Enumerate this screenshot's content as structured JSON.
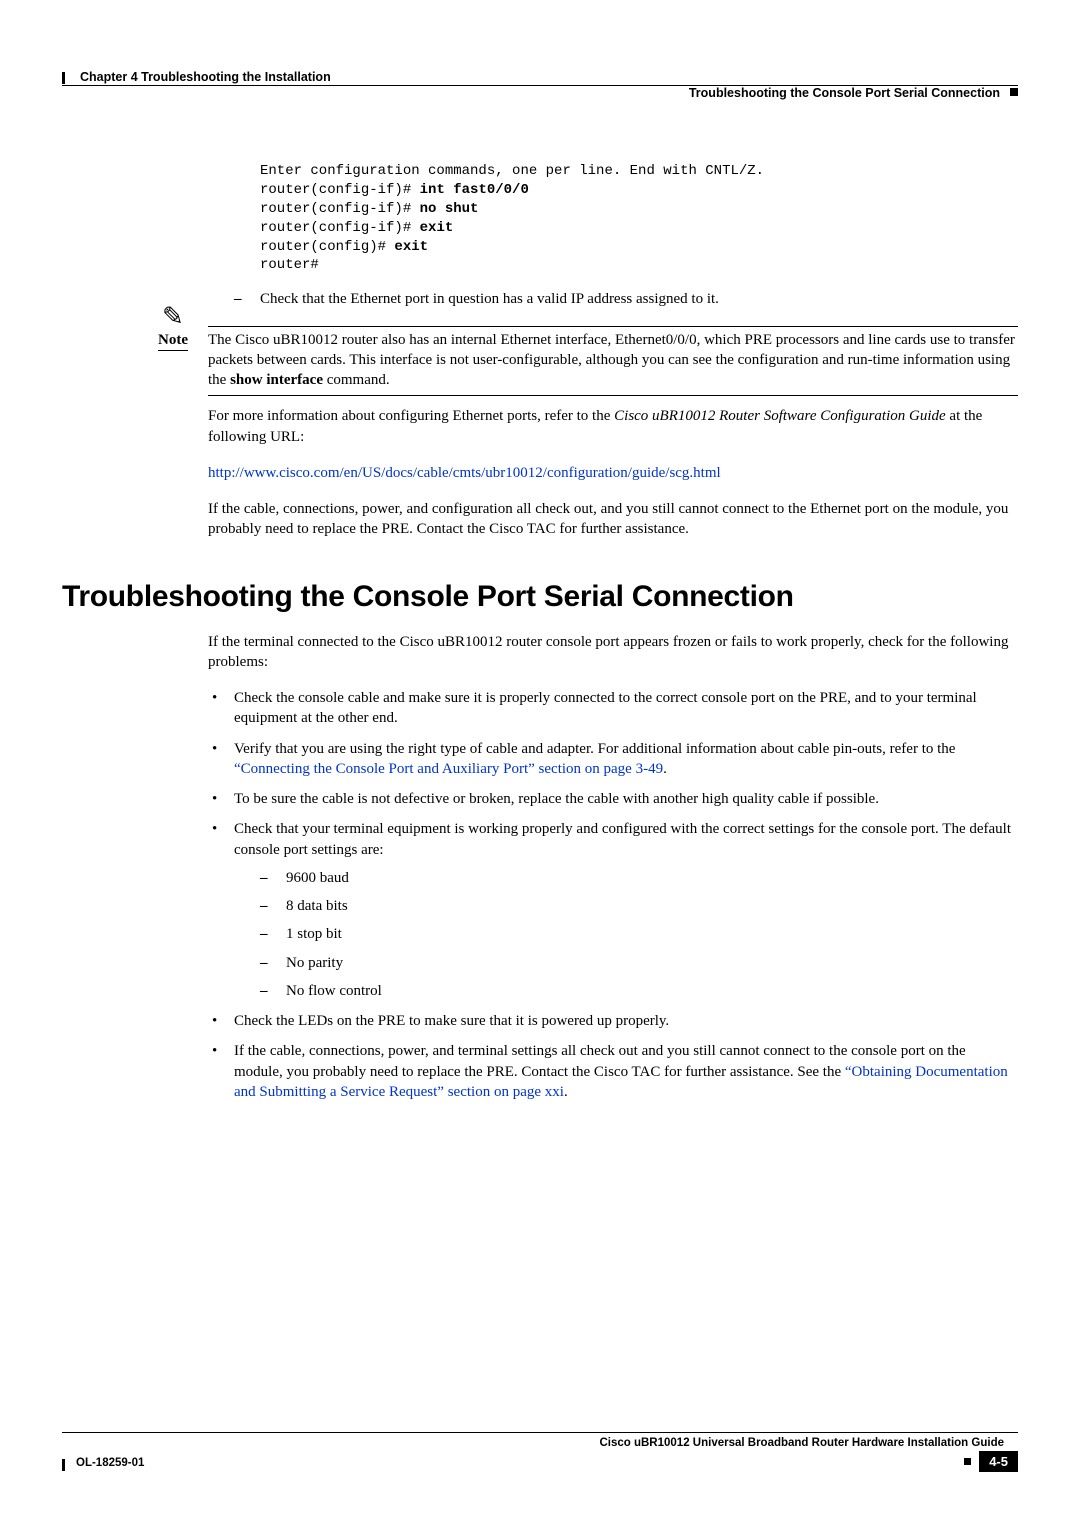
{
  "header": {
    "chapter": "Chapter 4      Troubleshooting the Installation",
    "subtitle": "Troubleshooting the Console Port Serial Connection"
  },
  "code": {
    "l1": "Enter configuration commands, one per line. End with CNTL/Z.",
    "l2a": "router(config-if)# ",
    "l2b": "int fast0/0/0",
    "l3a": "router(config-if)# ",
    "l3b": "no shut",
    "l4a": "router(config-if)# ",
    "l4b": "exit",
    "l5a": "router(config)# ",
    "l5b": "exit",
    "l6": "router#"
  },
  "dash1": "Check that the Ethernet port in question has a valid IP address assigned to it.",
  "note": {
    "label": "Note",
    "text_a": "The Cisco uBR10012 router also has an internal Ethernet interface, Ethernet0/0/0, which PRE processors and line cards use to transfer packets between cards. This interface is not user-configurable, although you can see the configuration and run-time information using the ",
    "text_b": "show interface",
    "text_c": " command."
  },
  "para1_a": "For more information about configuring Ethernet ports, refer to the ",
  "para1_b": "Cisco uBR10012 Router Software Configuration Guide",
  "para1_c": " at the following URL:",
  "url1": "http://www.cisco.com/en/US/docs/cable/cmts/ubr10012/configuration/guide/scg.html",
  "para2": "If the cable, connections, power, and configuration all check out, and you still cannot connect to the Ethernet port on the module, you probably need to replace the PRE. Contact the Cisco TAC for further assistance.",
  "h1": "Troubleshooting the Console Port Serial Connection",
  "intro": "If the terminal connected to the Cisco uBR10012 router console port appears frozen or fails to work properly, check for the following problems:",
  "b1": "Check the console cable and make sure it is properly connected to the correct console port on the PRE, and to your terminal equipment at the other end.",
  "b2_a": "Verify that you are using the right type of cable and adapter. For additional information about cable pin-outs, refer to the ",
  "b2_link": "“Connecting the Console Port and Auxiliary Port” section on page 3-49",
  "b2_c": ".",
  "b3": "To be sure the cable is not defective or broken, replace the cable with another high quality cable if possible.",
  "b4": "Check that your terminal equipment is working properly and configured with the correct settings for the console port. The default console port settings are:",
  "settings": [
    "9600 baud",
    "8 data bits",
    "1 stop bit",
    "No parity",
    "No flow control"
  ],
  "b5": "Check the LEDs on the PRE to make sure that it is powered up properly.",
  "b6_a": "If the cable, connections, power, and terminal settings all check out and you still cannot connect to the console port on the module, you probably need to replace the PRE. Contact the Cisco TAC for further assistance. See the ",
  "b6_link": "“Obtaining Documentation and Submitting a Service Request” section on page xxi",
  "b6_c": ".",
  "footer": {
    "title": "Cisco uBR10012 Universal Broadband Router Hardware Installation Guide",
    "doc": "OL-18259-01",
    "page": "4-5"
  }
}
